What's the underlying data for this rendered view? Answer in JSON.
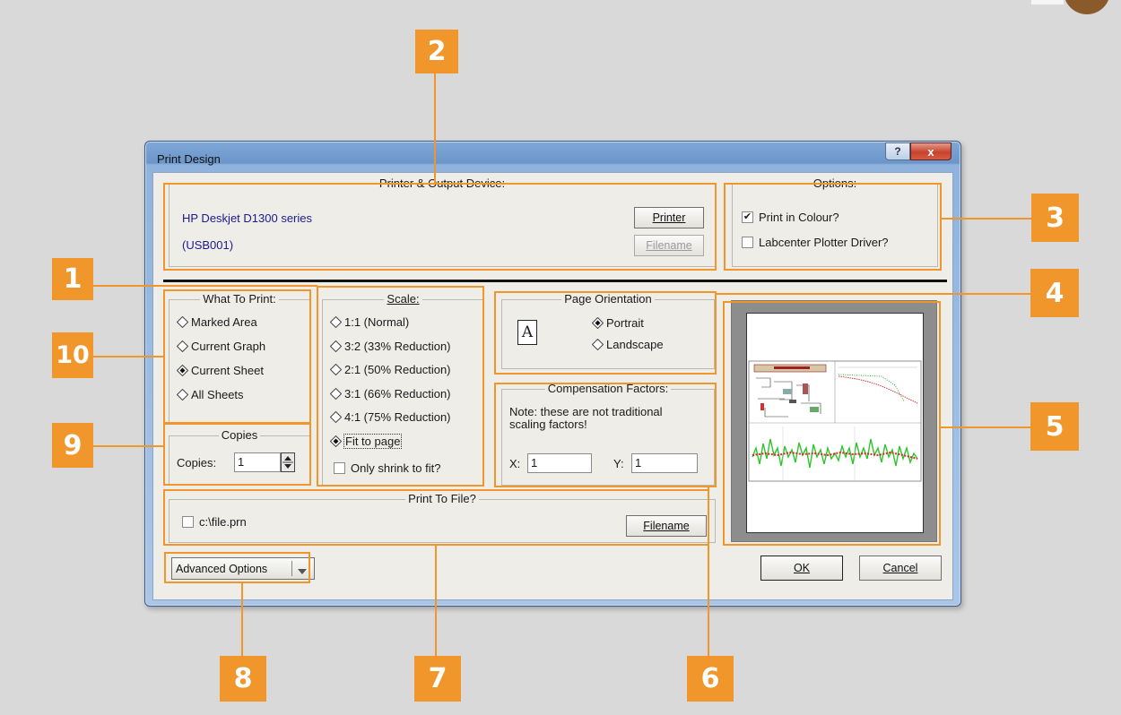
{
  "window": {
    "title": "Print Design",
    "help_label": "?",
    "close_label": "x"
  },
  "printer_group": {
    "legend": "Printer & Output Device:",
    "printer_name": "HP Deskjet D1300 series",
    "printer_port": "(USB001)",
    "printer_button": "Printer",
    "filename_button": "Filename"
  },
  "options_group": {
    "legend": "Options:",
    "print_in_colour": {
      "label": "Print in Colour?",
      "checked": true
    },
    "plotter_driver": {
      "label": "Labcenter Plotter Driver?",
      "checked": false
    }
  },
  "what_to_print": {
    "legend": "What To Print:",
    "options": [
      {
        "label": "Marked Area",
        "selected": false
      },
      {
        "label": "Current Graph",
        "selected": false
      },
      {
        "label": "Current Sheet",
        "selected": true
      },
      {
        "label": "All Sheets",
        "selected": false
      }
    ]
  },
  "copies_group": {
    "legend": "Copies",
    "label": "Copies:",
    "value": "1"
  },
  "scale_group": {
    "legend": "Scale:",
    "options": [
      {
        "label": "1:1 (Normal)",
        "selected": false
      },
      {
        "label": "3:2 (33% Reduction)",
        "selected": false
      },
      {
        "label": "2:1 (50% Reduction)",
        "selected": false
      },
      {
        "label": "3:1 (66% Reduction)",
        "selected": false
      },
      {
        "label": "4:1 (75% Reduction)",
        "selected": false
      },
      {
        "label": "Fit to page",
        "selected": true
      }
    ],
    "shrink_only": {
      "label": "Only shrink to fit?",
      "checked": false
    }
  },
  "orientation_group": {
    "legend": "Page Orientation",
    "icon_letter": "A",
    "portrait": {
      "label": "Portrait",
      "selected": true
    },
    "landscape": {
      "label": "Landscape",
      "selected": false
    }
  },
  "compensation_group": {
    "legend": "Compensation Factors:",
    "note": "Note: these are not traditional scaling factors!",
    "x_label": "X:",
    "x_value": "1",
    "y_label": "Y:",
    "y_value": "1"
  },
  "print_to_file_group": {
    "legend": "Print To File?",
    "file_path": "c:\\file.prn",
    "checked": false,
    "filename_button": "Filename"
  },
  "advanced_options": {
    "label": "Advanced Options"
  },
  "footer": {
    "ok": "OK",
    "cancel": "Cancel"
  },
  "annotations": [
    "1",
    "2",
    "3",
    "4",
    "5",
    "6",
    "7",
    "8",
    "9",
    "10"
  ],
  "colors": {
    "annotation": "#f0962a",
    "link_text": "#1a1a8c"
  }
}
